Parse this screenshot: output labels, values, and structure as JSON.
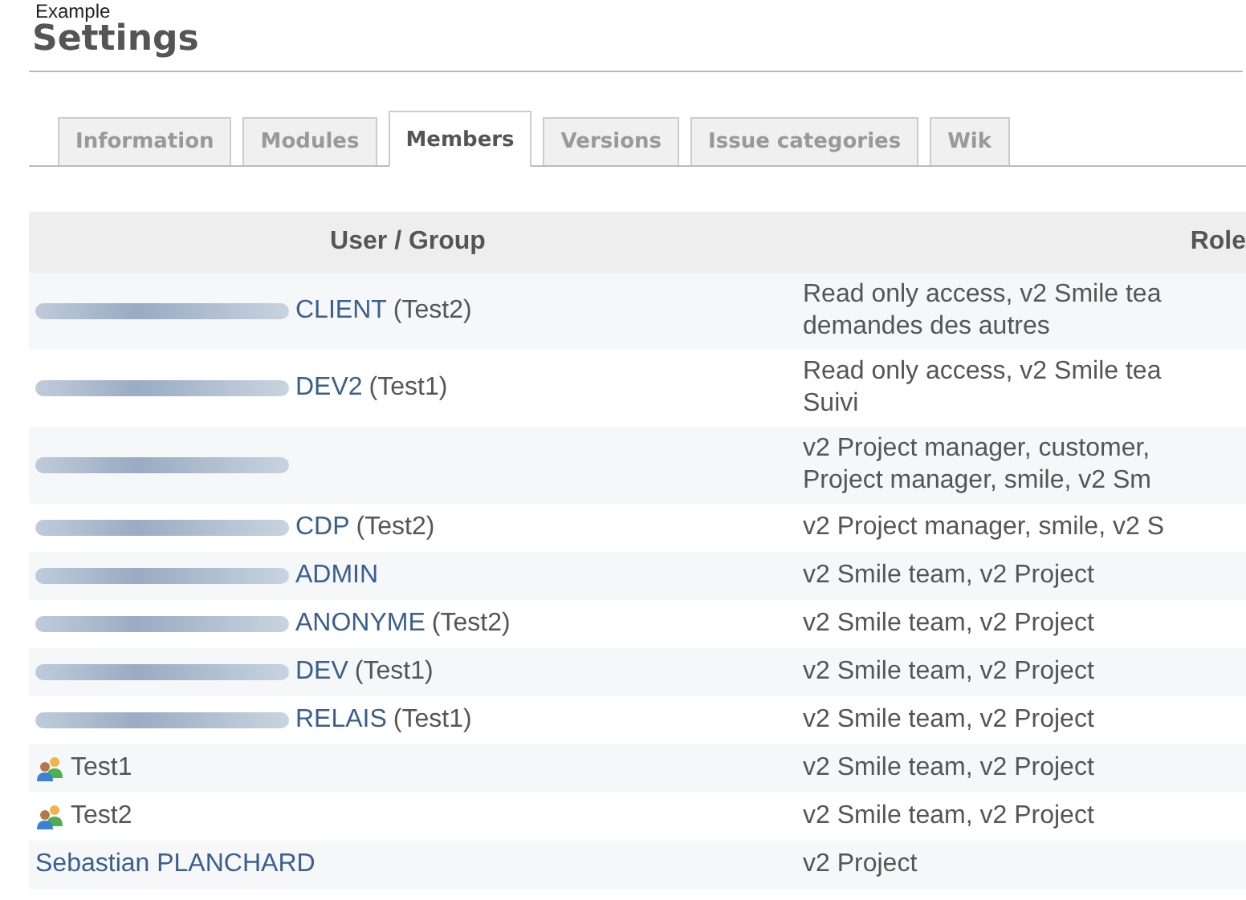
{
  "caption": "Example",
  "title": "Settings",
  "tabs": [
    {
      "label": "Information",
      "selected": false
    },
    {
      "label": "Modules",
      "selected": false
    },
    {
      "label": "Members",
      "selected": true
    },
    {
      "label": "Versions",
      "selected": false
    },
    {
      "label": "Issue categories",
      "selected": false
    },
    {
      "label": "Wik",
      "selected": false
    }
  ],
  "table": {
    "columns": [
      "User / Group",
      "Role"
    ],
    "rows": [
      {
        "kind": "user",
        "name": "CLIENT",
        "project": "(Test2)",
        "roles": [
          "Read only access, v2 Smile tea",
          "demandes des autres"
        ]
      },
      {
        "kind": "user",
        "name": "DEV2",
        "project": "(Test1)",
        "roles": [
          "Read only access, v2 Smile tea",
          "Suivi"
        ]
      },
      {
        "kind": "user",
        "roles": [
          "v2 Project manager, customer,",
          "Project manager, smile, v2 Sm"
        ]
      },
      {
        "kind": "user",
        "name": "CDP",
        "project": "(Test2)",
        "roles": [
          "v2 Project manager, smile, v2 S"
        ]
      },
      {
        "kind": "user",
        "name": "ADMIN",
        "roles": [
          "v2 Smile team, v2 Project"
        ]
      },
      {
        "kind": "user",
        "name": "ANONYME",
        "project": "(Test2)",
        "roles": [
          "v2 Smile team, v2 Project"
        ]
      },
      {
        "kind": "user",
        "name": "DEV",
        "project": "(Test1)",
        "roles": [
          "v2 Smile team, v2 Project"
        ]
      },
      {
        "kind": "user",
        "name": "RELAIS",
        "project": "(Test1)",
        "roles": [
          "v2 Smile team, v2 Project"
        ]
      },
      {
        "kind": "group",
        "name": "Test1",
        "roles": [
          "v2 Smile team, v2 Project"
        ]
      },
      {
        "kind": "group",
        "name": "Test2",
        "roles": [
          "v2 Smile team, v2 Project"
        ]
      },
      {
        "kind": "plain-user",
        "name": "Sebastian PLANCHARD",
        "roles": [
          "v2 Project"
        ]
      }
    ]
  }
}
